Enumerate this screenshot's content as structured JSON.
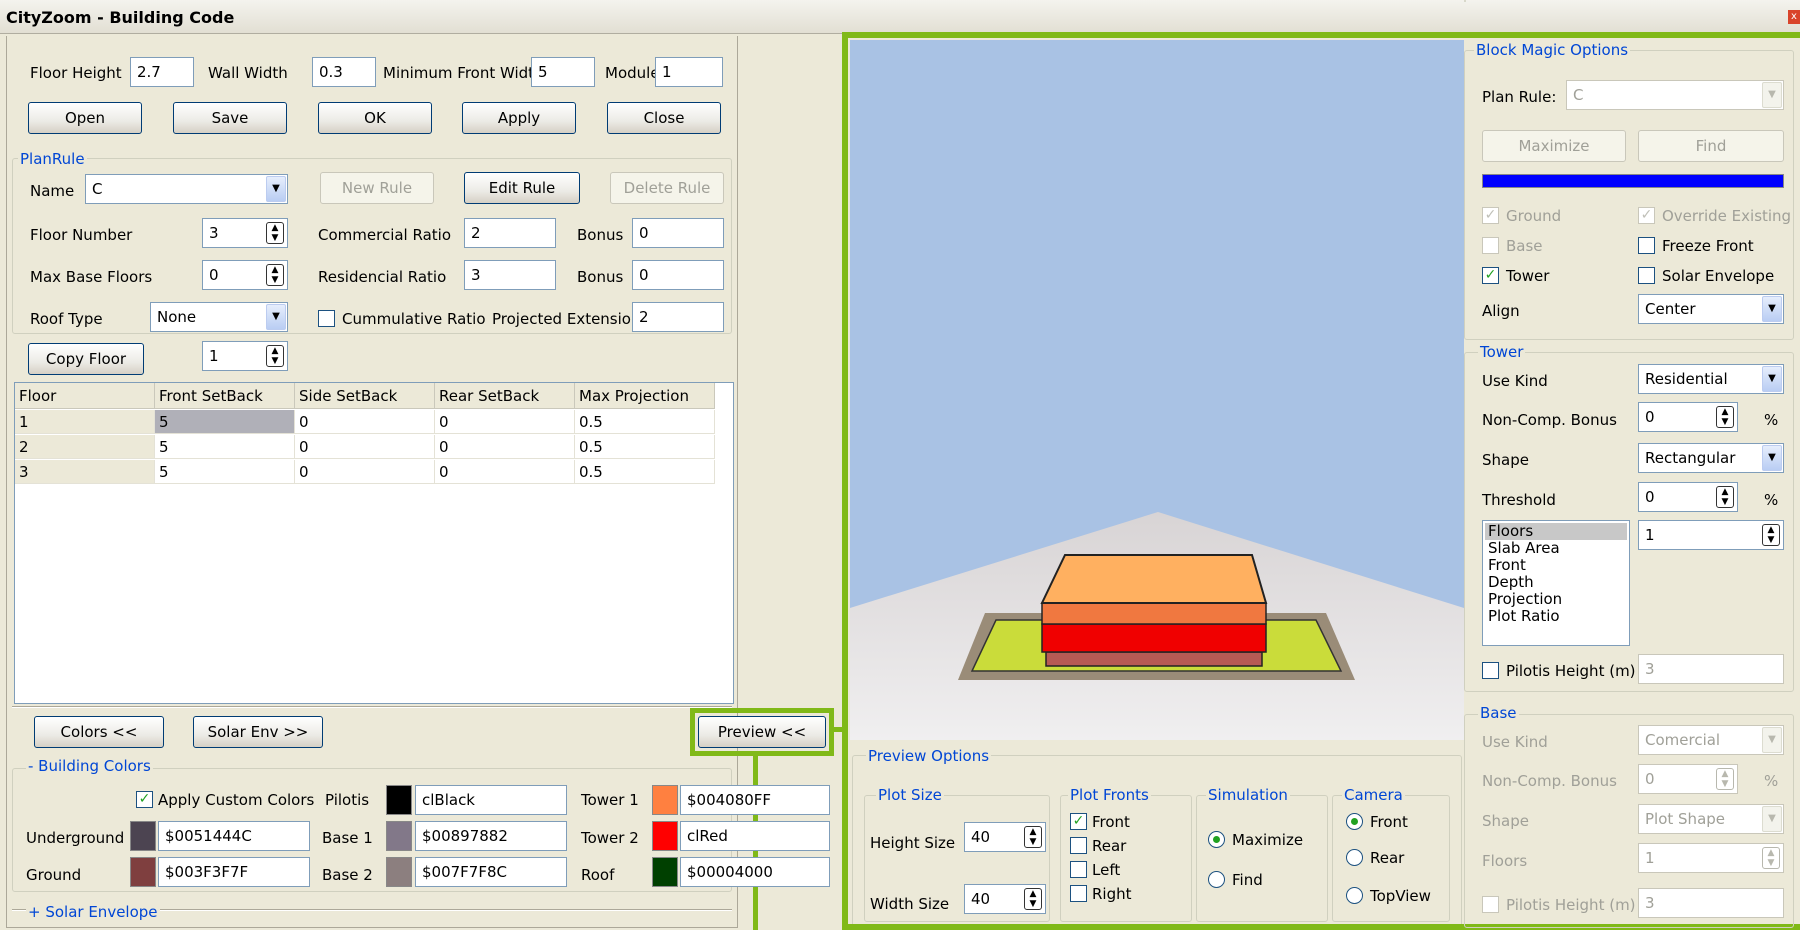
{
  "window": {
    "title": "CityZoom - Building Code",
    "close_glyph": "x"
  },
  "top": {
    "floor_height_label": "Floor Height",
    "floor_height": "2.7",
    "wall_width_label": "Wall Width",
    "wall_width": "0.3",
    "min_front_label": "Minimum Front Width",
    "min_front": "5",
    "module_label": "Module",
    "module": "1",
    "buttons": {
      "open": "Open",
      "save": "Save",
      "ok": "OK",
      "apply": "Apply",
      "close": "Close"
    }
  },
  "plan_rule": {
    "group_title": "PlanRule",
    "name_label": "Name",
    "name_value": "C",
    "new_rule": "New Rule",
    "edit_rule": "Edit Rule",
    "delete_rule": "Delete Rule",
    "floor_number_label": "Floor Number",
    "floor_number": "3",
    "commercial_ratio_label": "Commercial Ratio",
    "commercial_ratio": "2",
    "bonus_label": "Bonus",
    "bonus1": "0",
    "max_base_label": "Max Base Floors",
    "max_base": "0",
    "residencial_ratio_label": "Residencial Ratio",
    "residencial_ratio": "3",
    "bonus2": "0",
    "roof_type_label": "Roof Type",
    "roof_type": "None",
    "cumulative_label": "Cummulative Ratio",
    "cumulative_checked": false,
    "projected_label": "Projected Extension",
    "projected": "2",
    "copy_floor": "Copy Floor",
    "copy_floor_value": "1"
  },
  "table": {
    "headers": [
      "Floor",
      "Front SetBack",
      "Side SetBack",
      "Rear SetBack",
      "Max Projection"
    ],
    "rows": [
      [
        "1",
        "5",
        "0",
        "0",
        "0.5"
      ],
      [
        "2",
        "5",
        "0",
        "0",
        "0.5"
      ],
      [
        "3",
        "5",
        "0",
        "0",
        "0.5"
      ]
    ]
  },
  "bottom": {
    "colors_btn": "Colors <<",
    "solar_btn": "Solar Env >>",
    "preview_btn": "Preview <<",
    "building_colors_title": "- Building Colors",
    "apply_custom_label": "Apply Custom Colors",
    "apply_custom_checked": true,
    "solar_envelope_title": "+ Solar Envelope",
    "pilotis_label": "Pilotis",
    "pilotis_value": "clBlack",
    "pilotis_color": "#000000",
    "tower1_label": "Tower 1",
    "tower1_value": "$004080FF",
    "tower1_color": "#ff8040",
    "underground_label": "Underground",
    "underground_value": "$0051444C",
    "underground_color": "#4c4451",
    "base1_label": "Base 1",
    "base1_value": "$00897882",
    "base1_color": "#827889",
    "tower2_label": "Tower 2",
    "tower2_value": "clRed",
    "tower2_color": "#ff0000",
    "ground_label": "Ground",
    "ground_value": "$003F3F7F",
    "ground_color": "#7f3f3f",
    "base2_label": "Base 2",
    "base2_value": "$007F7F8C",
    "base2_color": "#8c7f7f",
    "roof_label": "Roof",
    "roof_value": "$00004000",
    "roof_color": "#004000"
  },
  "preview": {
    "options_title": "Preview Options",
    "plot_size_title": "Plot Size",
    "height_size_label": "Height Size",
    "height_size": "40",
    "width_size_label": "Width Size",
    "width_size": "40",
    "plot_fronts_title": "Plot Fronts",
    "fronts": [
      {
        "label": "Front",
        "checked": true
      },
      {
        "label": "Rear",
        "checked": false
      },
      {
        "label": "Left",
        "checked": false
      },
      {
        "label": "Right",
        "checked": false
      }
    ],
    "simulation_title": "Simulation",
    "sim_maximize": "Maximize",
    "sim_find": "Find",
    "camera_title": "Camera",
    "cam_front": "Front",
    "cam_rear": "Rear",
    "cam_top": "TopView"
  },
  "block_magic": {
    "title": "Block Magic Options",
    "plan_rule_label": "Plan Rule:",
    "plan_rule_value": "C",
    "maximize_btn": "Maximize",
    "find_btn": "Find",
    "ground_label": "Ground",
    "override_label": "Override Existing",
    "base_label": "Base",
    "freeze_label": "Freeze Front",
    "tower_label": "Tower",
    "solar_label": "Solar Envelope",
    "align_label": "Align",
    "align_value": "Center",
    "progress_color": "#0000ff"
  },
  "tower": {
    "title": "Tower",
    "use_kind_label": "Use Kind",
    "use_kind": "Residential",
    "noncomp_label": "Non-Comp. Bonus",
    "noncomp": "0",
    "pct": "%",
    "shape_label": "Shape",
    "shape": "Rectangular",
    "threshold_label": "Threshold",
    "threshold": "0",
    "list": [
      "Floors",
      "Slab Area",
      "Front",
      "Depth",
      "Projection",
      "Plot Ratio"
    ],
    "list_value": "1",
    "pilotis_label": "Pilotis Height (m)",
    "pilotis_value": "3"
  },
  "base": {
    "title": "Base",
    "use_kind_label": "Use Kind",
    "use_kind": "Comercial",
    "noncomp_label": "Non-Comp. Bonus",
    "noncomp": "0",
    "shape_label": "Shape",
    "shape": "Plot Shape",
    "floors_label": "Floors",
    "floors": "1",
    "pilotis_label": "Pilotis Height (m)",
    "pilotis_value": "3"
  },
  "colors": {
    "accent_green": "#80b918",
    "sky": "#a9c2e4",
    "group_title": "#0046d5"
  }
}
